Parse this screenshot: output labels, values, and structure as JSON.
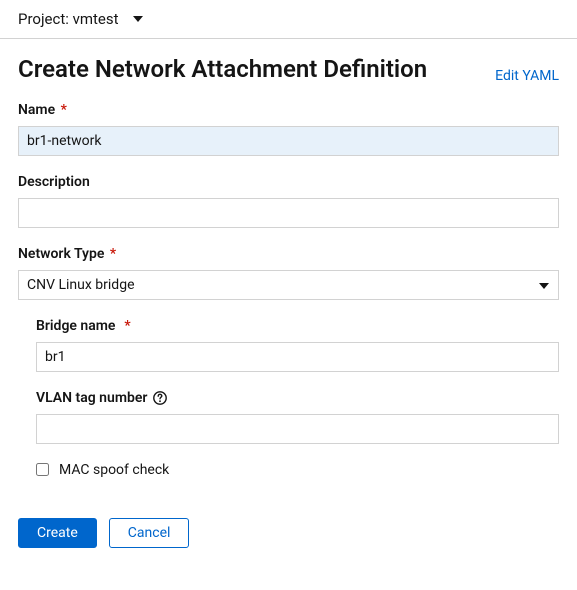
{
  "project": {
    "label": "Project: vmtest"
  },
  "header": {
    "title": "Create Network Attachment Definition",
    "editYaml": "Edit YAML"
  },
  "form": {
    "name": {
      "label": "Name",
      "value": "br1-network"
    },
    "description": {
      "label": "Description",
      "value": ""
    },
    "networkType": {
      "label": "Network Type",
      "value": "CNV Linux bridge"
    },
    "bridgeName": {
      "label": "Bridge name",
      "value": "br1"
    },
    "vlanTag": {
      "label": "VLAN tag number",
      "value": ""
    },
    "macSpoof": {
      "label": "MAC spoof check"
    }
  },
  "buttons": {
    "create": "Create",
    "cancel": "Cancel"
  }
}
